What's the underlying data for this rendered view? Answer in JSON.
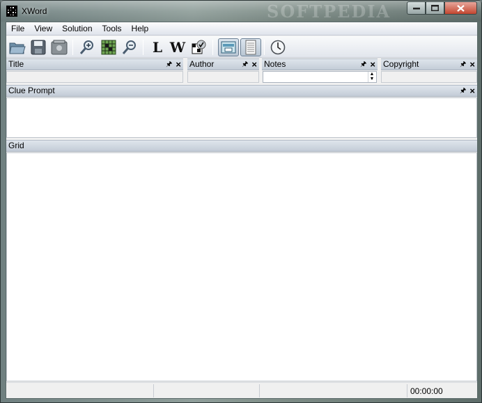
{
  "window": {
    "title": "XWord",
    "watermark": "SOFTPEDIA"
  },
  "menu": [
    "File",
    "View",
    "Solution",
    "Tools",
    "Help"
  ],
  "toolbar": {
    "buttons": [
      {
        "icon": "open-folder-icon"
      },
      {
        "icon": "save-icon"
      },
      {
        "icon": "delete-icon"
      },
      {
        "icon": "zoom-in-icon"
      },
      {
        "icon": "zoom-fit-icon"
      },
      {
        "icon": "zoom-out-icon"
      },
      {
        "icon": "check-letter-icon",
        "glyph": "L"
      },
      {
        "icon": "check-word-icon",
        "glyph": "W"
      },
      {
        "icon": "check-grid-icon"
      },
      {
        "icon": "layout-icon",
        "active": true
      },
      {
        "icon": "notes-icon",
        "active": true
      },
      {
        "icon": "timer-icon"
      }
    ]
  },
  "panes": {
    "title": {
      "label": "Title"
    },
    "author": {
      "label": "Author"
    },
    "notes": {
      "label": "Notes"
    },
    "copyright": {
      "label": "Copyright"
    },
    "clue_prompt": {
      "label": "Clue Prompt"
    },
    "grid": {
      "label": "Grid"
    }
  },
  "status": {
    "timer": "00:00:00"
  },
  "colors": {
    "accent": "#c3462f",
    "pane_header": "#c3ccd7"
  }
}
